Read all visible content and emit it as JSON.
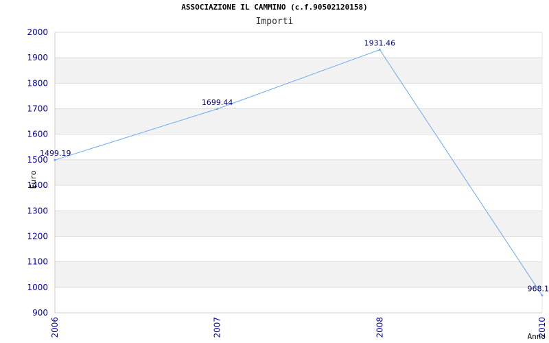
{
  "chart_data": {
    "type": "line",
    "title": "ASSOCIAZIONE IL CAMMINO (c.f.90502120158)",
    "subtitle": "Importi",
    "xlabel": "Anno",
    "ylabel": "Euro",
    "x": [
      "2006",
      "2007",
      "2008",
      "2010"
    ],
    "series": [
      {
        "values": [
          1499.19,
          1699.44,
          1931.46,
          968.1
        ]
      }
    ],
    "data_labels": [
      "1499.19",
      "1699.44",
      "1931.46",
      "968.1"
    ],
    "ylim": [
      900,
      2000
    ],
    "yticks": [
      900,
      1000,
      1100,
      1200,
      1300,
      1400,
      1500,
      1600,
      1700,
      1800,
      1900,
      2000
    ],
    "grid": true,
    "line_color": "#6aa8ee",
    "band_color": "#f2f2f2",
    "tick_color": "#0000aa"
  }
}
